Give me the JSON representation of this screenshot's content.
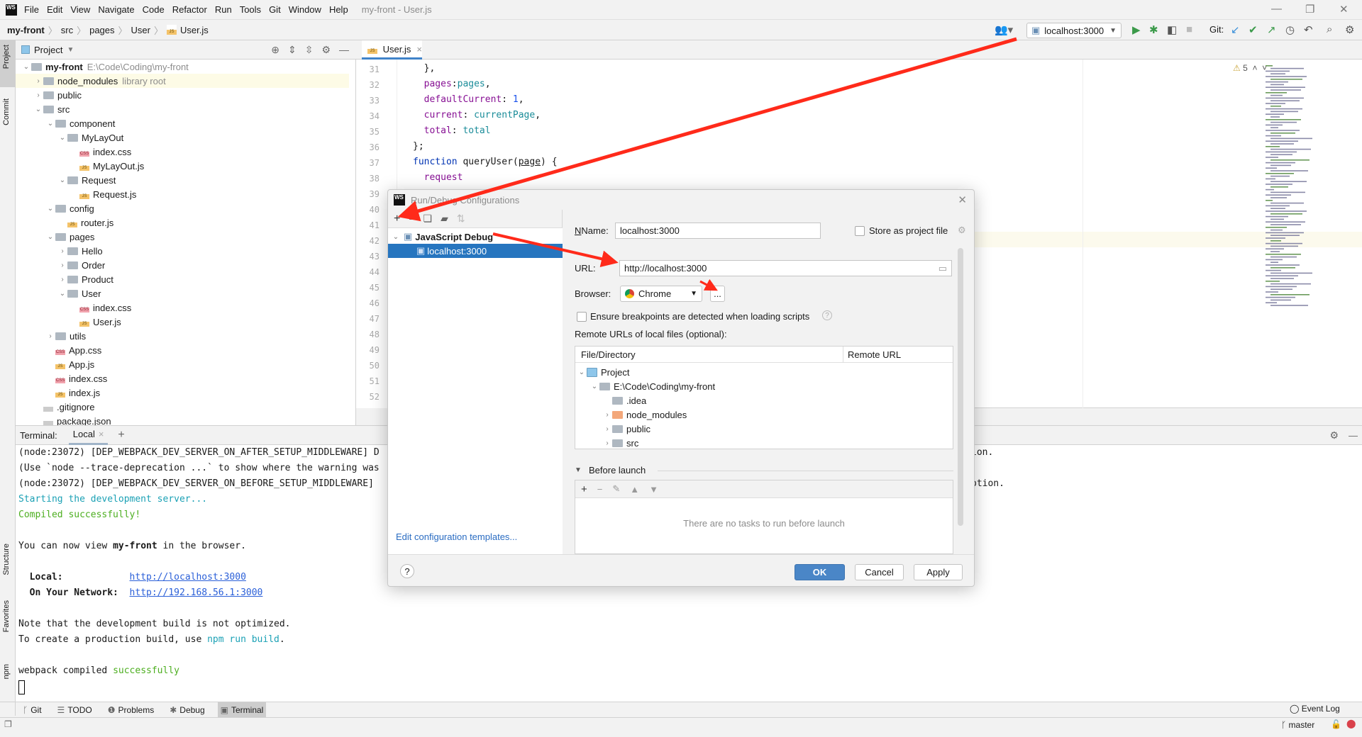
{
  "window": {
    "title": "my-front - User.js",
    "logo": "WS"
  },
  "menu": [
    "File",
    "Edit",
    "View",
    "Navigate",
    "Code",
    "Refactor",
    "Run",
    "Tools",
    "Git",
    "Window",
    "Help"
  ],
  "breadcrumb": [
    "my-front",
    "src",
    "pages",
    "User",
    "User.js"
  ],
  "toolbar": {
    "run_config": "localhost:3000",
    "git_label": "Git:"
  },
  "side_strip": {
    "top": [
      "Project",
      "Commit"
    ],
    "bottom": [
      "Structure",
      "Favorites",
      "npm"
    ]
  },
  "project": {
    "header": "Project",
    "tree": [
      {
        "label": "my-front",
        "extra": "E:\\Code\\Coding\\my-front",
        "depth": 0,
        "type": "folder",
        "open": true,
        "bold": true
      },
      {
        "label": "node_modules",
        "extra": "library root",
        "depth": 1,
        "type": "folder",
        "open": false
      },
      {
        "label": "public",
        "depth": 1,
        "type": "folder",
        "open": false
      },
      {
        "label": "src",
        "depth": 1,
        "type": "folder",
        "open": true
      },
      {
        "label": "component",
        "depth": 2,
        "type": "folder",
        "open": true
      },
      {
        "label": "MyLayOut",
        "depth": 3,
        "type": "folder",
        "open": true
      },
      {
        "label": "index.css",
        "depth": 4,
        "type": "css"
      },
      {
        "label": "MyLayOut.js",
        "depth": 4,
        "type": "js"
      },
      {
        "label": "Request",
        "depth": 3,
        "type": "folder",
        "open": true
      },
      {
        "label": "Request.js",
        "depth": 4,
        "type": "js"
      },
      {
        "label": "config",
        "depth": 2,
        "type": "folder",
        "open": true
      },
      {
        "label": "router.js",
        "depth": 3,
        "type": "js"
      },
      {
        "label": "pages",
        "depth": 2,
        "type": "folder",
        "open": true
      },
      {
        "label": "Hello",
        "depth": 3,
        "type": "folder",
        "open": false
      },
      {
        "label": "Order",
        "depth": 3,
        "type": "folder",
        "open": false
      },
      {
        "label": "Product",
        "depth": 3,
        "type": "folder",
        "open": false
      },
      {
        "label": "User",
        "depth": 3,
        "type": "folder",
        "open": true
      },
      {
        "label": "index.css",
        "depth": 4,
        "type": "css"
      },
      {
        "label": "User.js",
        "depth": 4,
        "type": "js"
      },
      {
        "label": "utils",
        "depth": 2,
        "type": "folder",
        "open": false
      },
      {
        "label": "App.css",
        "depth": 2,
        "type": "css"
      },
      {
        "label": "App.js",
        "depth": 2,
        "type": "js"
      },
      {
        "label": "index.css",
        "depth": 2,
        "type": "css"
      },
      {
        "label": "index.js",
        "depth": 2,
        "type": "js"
      },
      {
        "label": ".gitignore",
        "depth": 1,
        "type": "file"
      },
      {
        "label": "package.json",
        "depth": 1,
        "type": "file"
      }
    ]
  },
  "editor": {
    "tab": "User.js",
    "warnings": "5",
    "line_numbers": [
      "31",
      "32",
      "33",
      "34",
      "35",
      "36",
      "37",
      "38",
      "39",
      "40",
      "41",
      "42",
      "43",
      "44",
      "45",
      "46",
      "47",
      "48",
      "49",
      "50",
      "51",
      "52"
    ],
    "lines": [
      [
        {
          "t": "  },",
          "c": ""
        }
      ],
      [
        {
          "t": "  pages",
          "c": "prop"
        },
        {
          "t": ":",
          "c": ""
        },
        {
          "t": "pages",
          "c": "var"
        },
        {
          "t": ",",
          "c": ""
        }
      ],
      [
        {
          "t": "  defaultCurrent",
          "c": "prop"
        },
        {
          "t": ": ",
          "c": ""
        },
        {
          "t": "1",
          "c": "num"
        },
        {
          "t": ",",
          "c": ""
        }
      ],
      [
        {
          "t": "  current",
          "c": "prop"
        },
        {
          "t": ": ",
          "c": ""
        },
        {
          "t": "currentPage",
          "c": "var"
        },
        {
          "t": ",",
          "c": ""
        }
      ],
      [
        {
          "t": "  total",
          "c": "prop"
        },
        {
          "t": ": ",
          "c": ""
        },
        {
          "t": "total",
          "c": "var"
        }
      ],
      [
        {
          "t": "};",
          "c": ""
        }
      ],
      [
        {
          "t": "function ",
          "c": "kw"
        },
        {
          "t": "queryUser(",
          "c": ""
        },
        {
          "t": "page",
          "c": "u"
        },
        {
          "t": ") {",
          "c": ""
        }
      ],
      [
        {
          "t": "  request",
          "c": "prop"
        }
      ]
    ]
  },
  "terminal": {
    "label": "Terminal:",
    "tab": "Local",
    "lines": [
      [
        {
          "t": "(node:23072) [DEP_WEBPACK_DEV_SERVER_ON_AFTER_SETUP_MIDDLEWARE] D",
          "c": ""
        }
      ],
      [
        {
          "t": "(Use `node --trace-deprecation ...` to show where the warning was",
          "c": ""
        }
      ],
      [
        {
          "t": "(node:23072) [DEP_WEBPACK_DEV_SERVER_ON_BEFORE_SETUP_MIDDLEWARE]",
          "c": ""
        }
      ],
      [
        {
          "t": "Starting the development server...",
          "c": "cyan"
        }
      ],
      [
        {
          "t": "Compiled successfully!",
          "c": "green"
        }
      ],
      [],
      [
        {
          "t": "You can now view ",
          "c": ""
        },
        {
          "t": "my-front",
          "c": "bold"
        },
        {
          "t": " in the browser.",
          "c": ""
        }
      ],
      [],
      [
        {
          "t": "  Local:            ",
          "c": "bold"
        },
        {
          "t": "http://localhost:3000",
          "c": "link"
        }
      ],
      [
        {
          "t": "  On Your Network:  ",
          "c": "bold"
        },
        {
          "t": "http://192.168.56.1:3000",
          "c": "link"
        }
      ],
      [],
      [
        {
          "t": "Note that the development build is not optimized.",
          "c": ""
        }
      ],
      [
        {
          "t": "To create a production build, use ",
          "c": ""
        },
        {
          "t": "npm run build",
          "c": "cyan"
        },
        {
          "t": ".",
          "c": ""
        }
      ],
      [],
      [
        {
          "t": "webpack compiled ",
          "c": ""
        },
        {
          "t": "successfully",
          "c": "green"
        }
      ]
    ],
    "tails": [
      "ion.",
      "ption."
    ]
  },
  "tool_windows": [
    "Git",
    "TODO",
    "Problems",
    "Debug",
    "Terminal"
  ],
  "status": {
    "event_log": "Event Log",
    "branch": "master"
  },
  "dialog": {
    "title": "Run/Debug Configurations",
    "tree": {
      "group": "JavaScript Debug",
      "item": "localhost:3000"
    },
    "edit_templates": "Edit configuration templates...",
    "name_label": "Name:",
    "name_value": "localhost:3000",
    "store_label": "Store as project file",
    "url_label": "URL:",
    "url_value": "http://localhost:3000",
    "browser_label": "Browser:",
    "browser_value": "Chrome",
    "more_button": "...",
    "ensure_label": "Ensure breakpoints are detected when loading scripts",
    "remote_label": "Remote URLs of local files (optional):",
    "table_headers": [
      "File/Directory",
      "Remote URL"
    ],
    "table_rows": [
      {
        "label": "Project",
        "depth": 0,
        "chev": "open",
        "icon": "project"
      },
      {
        "label": "E:\\Code\\Coding\\my-front",
        "depth": 1,
        "chev": "open",
        "icon": "folder"
      },
      {
        "label": ".idea",
        "depth": 2,
        "chev": "",
        "icon": "folder"
      },
      {
        "label": "node_modules",
        "depth": 2,
        "chev": "closed",
        "icon": "orange"
      },
      {
        "label": "public",
        "depth": 2,
        "chev": "closed",
        "icon": "folder"
      },
      {
        "label": "src",
        "depth": 2,
        "chev": "closed",
        "icon": "folder"
      }
    ],
    "before_launch": "Before launch",
    "no_tasks": "There are no tasks to run before launch",
    "ok": "OK",
    "cancel": "Cancel",
    "apply": "Apply"
  },
  "colors": {
    "selection": "#2675bf",
    "ok_button": "#4a86c7",
    "annotation_arrow": "#ff2a1a"
  }
}
